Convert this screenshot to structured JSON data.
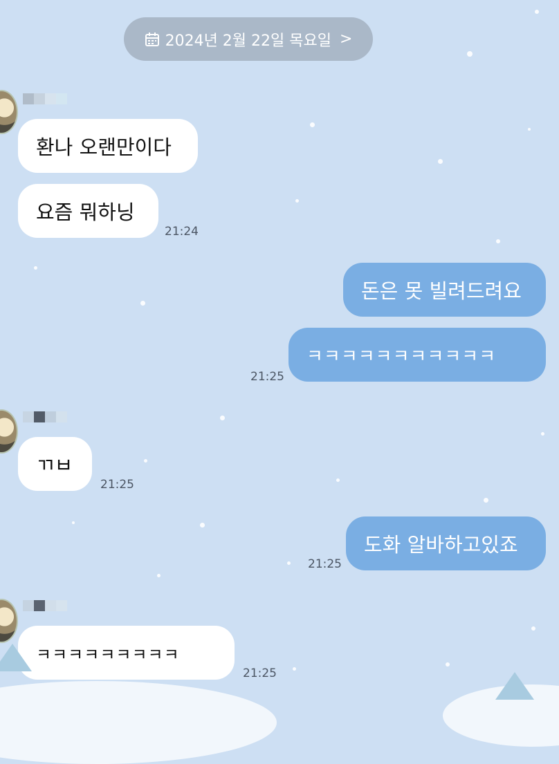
{
  "header": {
    "date": "2024년 2월 22일 목요일",
    "chevron": ">"
  },
  "messages": [
    {
      "side": "in",
      "text": "환나 오랜만이다"
    },
    {
      "side": "in",
      "text": "요즘 뭐하닝",
      "time": "21:24"
    },
    {
      "side": "out",
      "text": "돈은 못 빌려드려요"
    },
    {
      "side": "out",
      "text": "ㅋㅋㅋㅋㅋㅋㅋㅋㅋㅋㅋ",
      "time": "21:25"
    },
    {
      "side": "in",
      "text": "ㄲㅂ",
      "time": "21:25"
    },
    {
      "side": "out",
      "text": "도화 알바하고있죠",
      "time": "21:25"
    },
    {
      "side": "in",
      "text": "ㅋㅋㅋㅋㅋㅋㅋㅋㅋ",
      "time": "21:25"
    }
  ],
  "colors": {
    "background": "#cddff3",
    "incoming_bubble": "#ffffff",
    "outgoing_bubble": "#7aaee3",
    "date_pill": "#aab8c8"
  }
}
